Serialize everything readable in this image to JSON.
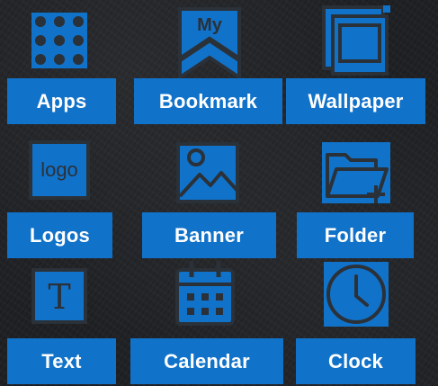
{
  "colors": {
    "accent": "#1172c9",
    "icon_stroke": "#2b3138",
    "background": "#1f2124"
  },
  "tiles": [
    {
      "id": "apps",
      "label": "Apps",
      "icon": "apps-grid-icon"
    },
    {
      "id": "bookmark",
      "label": "Bookmark",
      "icon": "bookmark-icon"
    },
    {
      "id": "wallpaper",
      "label": "Wallpaper",
      "icon": "wallpaper-icon"
    },
    {
      "id": "logos",
      "label": "Logos",
      "icon": "logo-icon",
      "icon_text": "logo"
    },
    {
      "id": "banner",
      "label": "Banner",
      "icon": "image-icon"
    },
    {
      "id": "folder",
      "label": "Folder",
      "icon": "folder-add-icon"
    },
    {
      "id": "text",
      "label": "Text",
      "icon": "text-icon",
      "icon_text": "T"
    },
    {
      "id": "calendar",
      "label": "Calendar",
      "icon": "calendar-icon"
    },
    {
      "id": "clock",
      "label": "Clock",
      "icon": "clock-icon"
    }
  ],
  "bookmark_icon_text": "My"
}
